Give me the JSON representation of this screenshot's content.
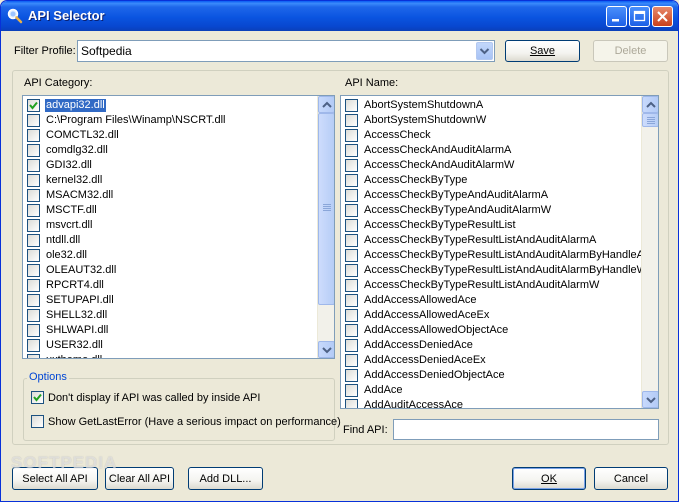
{
  "window": {
    "title": "API Selector",
    "accent": "#0a54e0"
  },
  "filter": {
    "label": "Filter Profile:",
    "value": "Softpedia",
    "save_label": "Save",
    "delete_label": "Delete"
  },
  "category": {
    "label": "API Category:",
    "items": [
      {
        "text": "advapi32.dll",
        "checked": true,
        "selected": true
      },
      {
        "text": "C:\\Program Files\\Winamp\\NSCRT.dll",
        "checked": false,
        "selected": false
      },
      {
        "text": "COMCTL32.dll",
        "checked": false,
        "selected": false
      },
      {
        "text": "comdlg32.dll",
        "checked": false,
        "selected": false
      },
      {
        "text": "GDI32.dll",
        "checked": false,
        "selected": false
      },
      {
        "text": "kernel32.dll",
        "checked": false,
        "selected": false
      },
      {
        "text": "MSACM32.dll",
        "checked": false,
        "selected": false
      },
      {
        "text": "MSCTF.dll",
        "checked": false,
        "selected": false
      },
      {
        "text": "msvcrt.dll",
        "checked": false,
        "selected": false
      },
      {
        "text": "ntdll.dll",
        "checked": false,
        "selected": false
      },
      {
        "text": "ole32.dll",
        "checked": false,
        "selected": false
      },
      {
        "text": "OLEAUT32.dll",
        "checked": false,
        "selected": false
      },
      {
        "text": "RPCRT4.dll",
        "checked": false,
        "selected": false
      },
      {
        "text": "SETUPAPI.dll",
        "checked": false,
        "selected": false
      },
      {
        "text": "SHELL32.dll",
        "checked": false,
        "selected": false
      },
      {
        "text": "SHLWAPI.dll",
        "checked": false,
        "selected": false
      },
      {
        "text": "USER32.dll",
        "checked": false,
        "selected": false
      },
      {
        "text": "uxtheme.dll",
        "checked": false,
        "selected": false
      }
    ]
  },
  "api_name": {
    "label": "API Name:",
    "items": [
      "AbortSystemShutdownA",
      "AbortSystemShutdownW",
      "AccessCheck",
      "AccessCheckAndAuditAlarmA",
      "AccessCheckAndAuditAlarmW",
      "AccessCheckByType",
      "AccessCheckByTypeAndAuditAlarmA",
      "AccessCheckByTypeAndAuditAlarmW",
      "AccessCheckByTypeResultList",
      "AccessCheckByTypeResultListAndAuditAlarmA",
      "AccessCheckByTypeResultListAndAuditAlarmByHandleA",
      "AccessCheckByTypeResultListAndAuditAlarmByHandleW",
      "AccessCheckByTypeResultListAndAuditAlarmW",
      "AddAccessAllowedAce",
      "AddAccessAllowedAceEx",
      "AddAccessAllowedObjectAce",
      "AddAccessDeniedAce",
      "AddAccessDeniedAceEx",
      "AddAccessDeniedObjectAce",
      "AddAce",
      "AddAuditAccessAce"
    ],
    "find_label": "Find API:",
    "find_value": ""
  },
  "options": {
    "title": "Options",
    "items": [
      {
        "text": "Don't display if API was called by inside API",
        "checked": true
      },
      {
        "text": "Show GetLastError (Have a serious impact on performance)",
        "checked": false
      }
    ]
  },
  "footer": {
    "select_all_label": "Select All API",
    "clear_all_label": "Clear All API",
    "add_dll_label": "Add DLL...",
    "ok_label": "OK",
    "cancel_label": "Cancel"
  },
  "watermark": "SOFTPEDIA"
}
